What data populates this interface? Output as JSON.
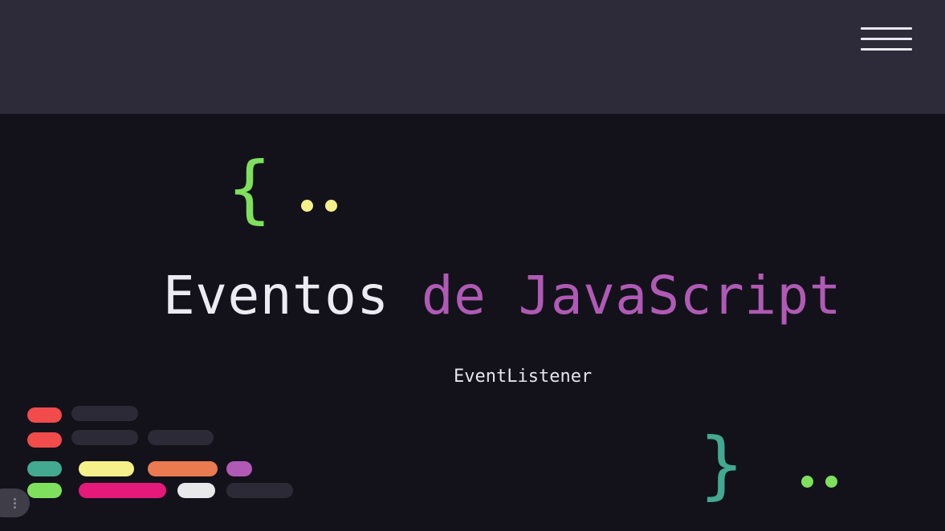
{
  "header": {
    "menu_icon": "hamburger-menu-icon"
  },
  "hero": {
    "open_brace": "{",
    "close_brace": "}",
    "title_part1": "Eventos ",
    "title_part2": "de JavaScript",
    "subtitle": "EventListener"
  },
  "colors": {
    "header_bg": "#2d2a3a",
    "page_bg": "#13121b",
    "title_white": "#ecebf1",
    "title_accent": "#b05ab5",
    "brace_open": "#7ee05d",
    "brace_close": "#43a991",
    "dots_top": "#f6f08a",
    "dots_bottom": "#7ee05d"
  }
}
